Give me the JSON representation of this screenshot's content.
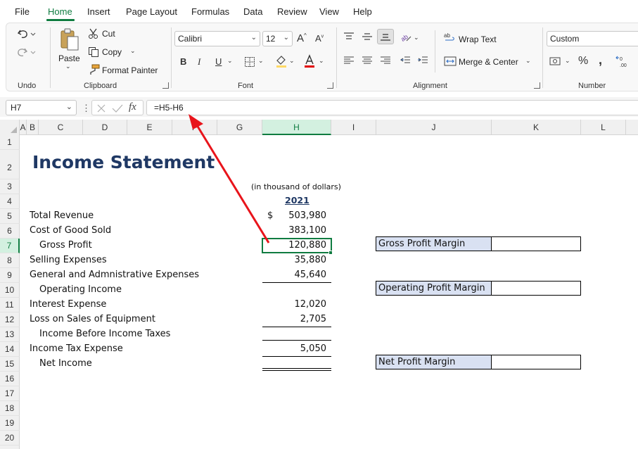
{
  "menu": {
    "items": [
      "File",
      "Home",
      "Insert",
      "Page Layout",
      "Formulas",
      "Data",
      "Review",
      "View",
      "Help"
    ],
    "active": "Home"
  },
  "ribbon": {
    "undo_group": "Undo",
    "clipboard": {
      "paste": "Paste",
      "cut": "Cut",
      "copy": "Copy",
      "format_painter": "Format Painter",
      "group": "Clipboard"
    },
    "font": {
      "name": "Calibri",
      "size": "12",
      "group": "Font",
      "font_color": "#e00000",
      "fill_color": "#ffd966"
    },
    "alignment": {
      "wrap_text": "Wrap Text",
      "merge_center": "Merge & Center",
      "group": "Alignment"
    },
    "number": {
      "format": "Custom",
      "group": "Number"
    }
  },
  "formula_bar": {
    "name_box": "H7",
    "formula": "=H5-H6"
  },
  "grid": {
    "columns": [
      "A",
      "B",
      "C",
      "D",
      "E",
      "F",
      "G",
      "H",
      "I",
      "J",
      "K",
      "L"
    ],
    "selected_column": "H",
    "rows": [
      "1",
      "2",
      "3",
      "4",
      "5",
      "6",
      "7",
      "8",
      "9",
      "10",
      "11",
      "12",
      "13",
      "14",
      "15",
      "16",
      "17",
      "18",
      "19",
      "20"
    ],
    "selected_row": "7"
  },
  "sheet": {
    "title": "Income Statement",
    "subtitle": "(in thousand of dollars)",
    "year": "2021",
    "currency": "$",
    "lines": [
      {
        "label": "Total Revenue",
        "value": "503,980"
      },
      {
        "label": "Cost of Good Sold",
        "value": "383,100"
      },
      {
        "label": "Gross Profit",
        "value": "120,880"
      },
      {
        "label": "Selling Expenses",
        "value": "35,880"
      },
      {
        "label": "General and Admnistrative Expenses",
        "value": "45,640"
      },
      {
        "label": "Operating Income",
        "value": ""
      },
      {
        "label": "Interest Expense",
        "value": "12,020"
      },
      {
        "label": "Loss on Sales of Equipment",
        "value": "2,705"
      },
      {
        "label": "Income Before Income Taxes",
        "value": ""
      },
      {
        "label": "Income Tax Expense",
        "value": "5,050"
      },
      {
        "label": "Net Income",
        "value": ""
      }
    ],
    "margins": {
      "gross": "Gross Profit Margin",
      "operating": "Operating Profit Margin",
      "net": "Net Profit Margin"
    }
  },
  "colors": {
    "accent": "#107c41",
    "title": "#1f3864",
    "margin_fill": "#d9e1f2",
    "arrow": "#e8141b"
  }
}
